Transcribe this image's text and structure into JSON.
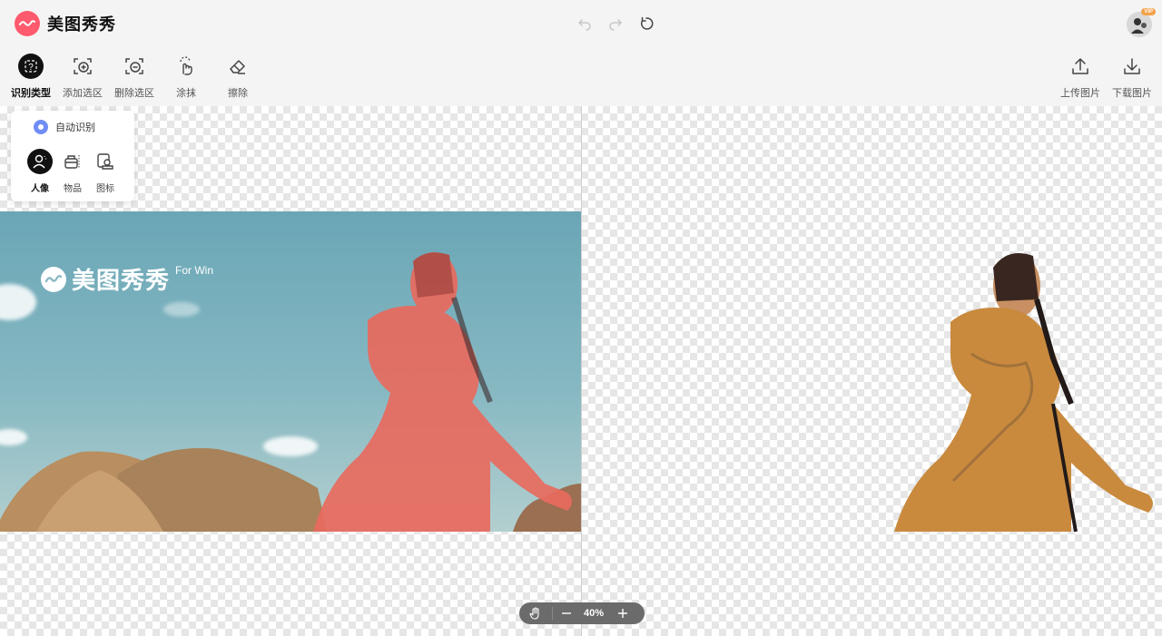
{
  "app": {
    "name": "美图秀秀"
  },
  "header": {
    "undo": "undo-icon",
    "redo": "redo-icon",
    "reset": "reset-icon",
    "vip_badge": "VIP"
  },
  "toolbar": {
    "left_tools": [
      {
        "label": "识别类型",
        "icon": "question-icon",
        "active": true
      },
      {
        "label": "添加选区",
        "icon": "add-selection-icon"
      },
      {
        "label": "删除选区",
        "icon": "remove-selection-icon"
      },
      {
        "label": "涂抹",
        "icon": "smear-hand-icon"
      },
      {
        "label": "擦除",
        "icon": "eraser-icon"
      }
    ],
    "right_tools": [
      {
        "label": "上传图片",
        "icon": "upload-icon"
      },
      {
        "label": "下载图片",
        "icon": "download-icon"
      }
    ]
  },
  "type_popup": {
    "auto_label": "自动识别",
    "types": [
      {
        "label": "人像",
        "icon": "person-icon",
        "active": true
      },
      {
        "label": "物品",
        "icon": "bag-icon"
      },
      {
        "label": "图标",
        "icon": "stamp-icon"
      }
    ]
  },
  "canvas": {
    "watermark": {
      "text": "美图秀秀",
      "subtext": "For Win"
    }
  },
  "zoom": {
    "value": "40%"
  },
  "colors": {
    "brand": "#ff5a6e",
    "radio": "#6f8df5",
    "highlight_overlay": "#e86a5e",
    "zoom_bg": "#6b6b6b"
  }
}
